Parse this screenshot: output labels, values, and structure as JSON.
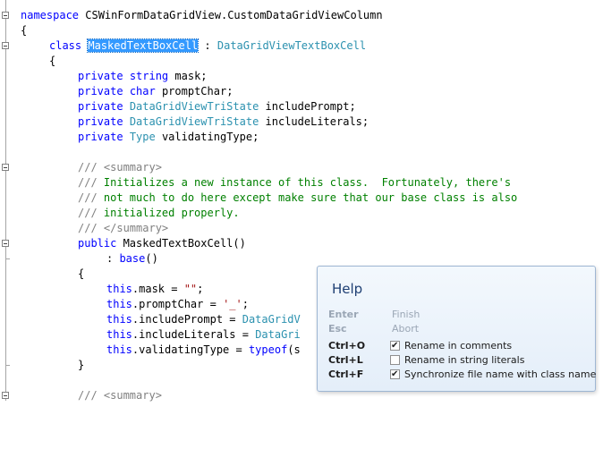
{
  "code": {
    "l1_kw": "namespace",
    "l1_name": " CSWinFormDataGridView.CustomDataGridViewColumn",
    "brace_open": "{",
    "brace_close": "}",
    "class_kw": "class",
    "class_name": "MaskedTextBoxCell",
    "class_colon": " : ",
    "class_base": "DataGridViewTextBoxCell",
    "private": "private",
    "string": "string",
    "char": "char",
    "tristate": "DataGridViewTriState",
    "type": "Type",
    "f_mask": " mask;",
    "f_prompt": " promptChar;",
    "f_incprompt": " includePrompt;",
    "f_incliterals": " includeLiterals;",
    "f_validating": " validatingType;",
    "doc_prefix": "/// ",
    "summary_open": "<summary>",
    "summary_close": "</summary>",
    "doc_line1": "Initializes a new instance of this class.  Fortunately, there's",
    "doc_line2": "not much to do here except make sure that our base class is also",
    "doc_line3": "initialized properly.",
    "public": "public",
    "ctor": " MaskedTextBoxCell()",
    "colon": ": ",
    "base": "base",
    "base_parens": "()",
    "this": "this",
    "s_mask_a": ".mask = ",
    "s_mask_str": "\"\"",
    "semi": ";",
    "s_prompt_a": ".promptChar = ",
    "s_prompt_chr": "'_'",
    "s_incprompt": ".includePrompt = ",
    "s_incprompt_val": "DataGridV",
    "s_inclit": ".includeLiterals = ",
    "s_inclit_val": "DataGri",
    "s_valid": ".validatingType = ",
    "typeof": "typeof",
    "s_valid_tail": "(s"
  },
  "help": {
    "title": "Help",
    "enter_key": "Enter",
    "enter_action": "Finish",
    "esc_key": "Esc",
    "esc_action": "Abort",
    "options": [
      {
        "key": "Ctrl+O",
        "label": "Rename in comments",
        "checked": true
      },
      {
        "key": "Ctrl+L",
        "label": "Rename in string literals",
        "checked": false
      },
      {
        "key": "Ctrl+F",
        "label": "Synchronize file name with class name",
        "checked": true
      }
    ]
  }
}
